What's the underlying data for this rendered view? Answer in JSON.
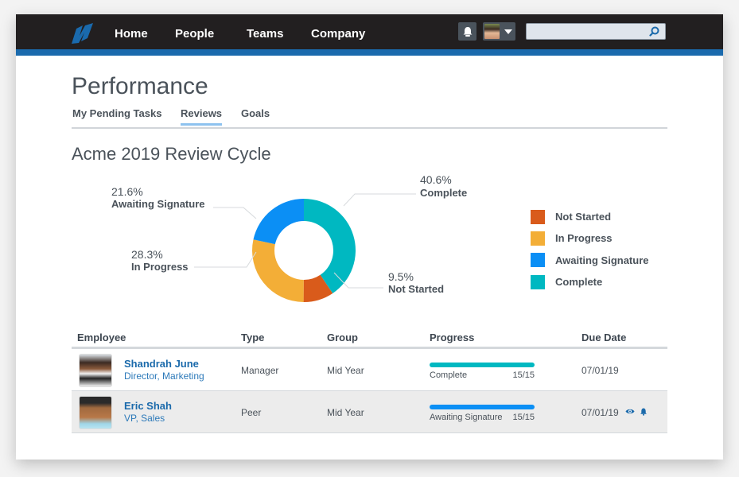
{
  "nav": {
    "items": [
      "Home",
      "People",
      "Teams",
      "Company"
    ],
    "search": {
      "value": "",
      "placeholder": ""
    },
    "icons": {
      "logo": "app-logo",
      "notifications": "bell-icon",
      "profile": "avatar",
      "menu": "chevron-down-icon",
      "search": "search-icon"
    }
  },
  "page": {
    "title": "Performance",
    "tabs": [
      {
        "label": "My Pending Tasks",
        "active": false
      },
      {
        "label": "Reviews",
        "active": true
      },
      {
        "label": "Goals",
        "active": false
      }
    ],
    "section_title": "Acme 2019 Review Cycle"
  },
  "colors": {
    "not_started": "#d95b1b",
    "in_progress": "#f3ae37",
    "awaiting_signature": "#0b8ff5",
    "complete": "#00b8c1",
    "link": "#1b6aab",
    "brand_blue": "#1a6aad"
  },
  "chart_data": {
    "type": "pie",
    "donut": true,
    "title": "Acme 2019 Review Cycle",
    "slices": [
      {
        "label": "Complete",
        "value": 40.6,
        "display": "40.6%",
        "color": "#00b8c1"
      },
      {
        "label": "Not Started",
        "value": 9.5,
        "display": "9.5%",
        "color": "#d95b1b"
      },
      {
        "label": "In Progress",
        "value": 28.3,
        "display": "28.3%",
        "color": "#f3ae37"
      },
      {
        "label": "Awaiting Signature",
        "value": 21.6,
        "display": "21.6%",
        "color": "#0b8ff5"
      }
    ],
    "legend": {
      "placement": "right",
      "entries": [
        {
          "label": "Not Started",
          "color": "#d95b1b"
        },
        {
          "label": "In Progress",
          "color": "#f3ae37"
        },
        {
          "label": "Awaiting Signature",
          "color": "#0b8ff5"
        },
        {
          "label": "Complete",
          "color": "#00b8c1"
        }
      ]
    }
  },
  "table": {
    "headers": [
      "Employee",
      "Type",
      "Group",
      "Progress",
      "Due Date"
    ],
    "rows": [
      {
        "name": "Shandrah June",
        "title": "Director, Marketing",
        "type": "Manager",
        "group": "Mid Year",
        "progress_label": "Complete",
        "progress_count": "15/15",
        "progress_fraction": 1.0,
        "progress_color": "#00b8c1",
        "due_date": "07/01/19",
        "actions": []
      },
      {
        "name": "Eric Shah",
        "title": "VP, Sales",
        "type": "Peer",
        "group": "Mid Year",
        "progress_label": "Awaiting Signature",
        "progress_count": "15/15",
        "progress_fraction": 1.0,
        "progress_color": "#0b8ff5",
        "due_date": "07/01/19",
        "actions": [
          "eye-icon",
          "bell-icon"
        ]
      }
    ]
  }
}
